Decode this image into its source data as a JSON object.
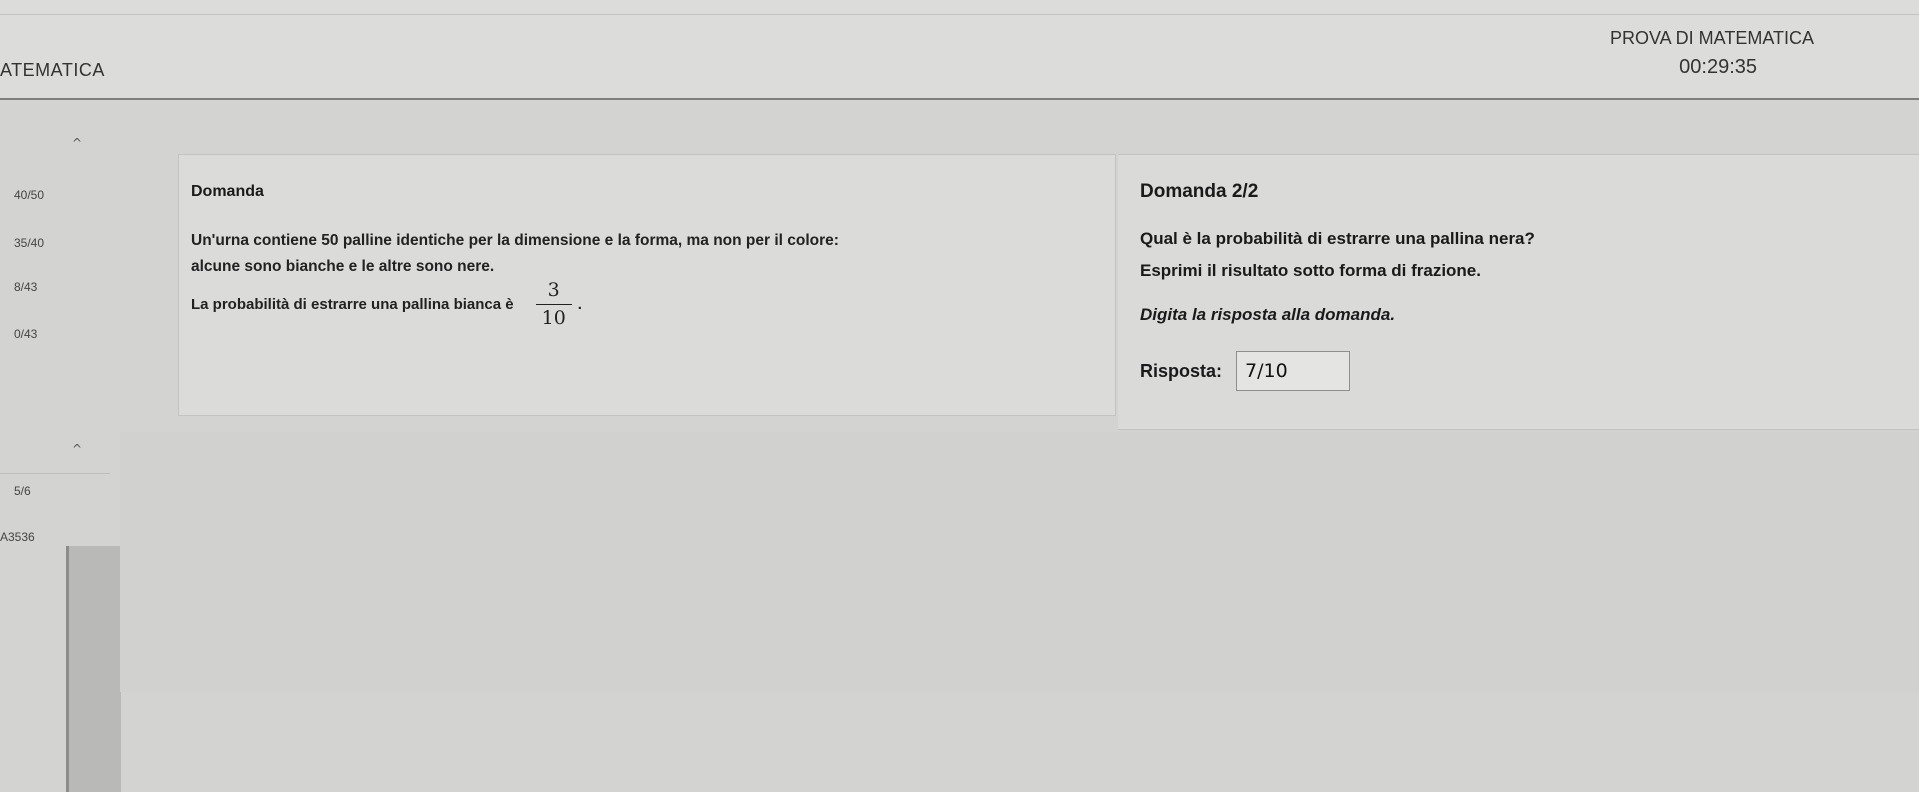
{
  "header": {
    "brand": "ATEMATICA",
    "exam_title": "PROVA DI MATEMATICA",
    "timer": "00:29:35"
  },
  "sidebar": {
    "caret_up": "^",
    "rows": [
      "40/50",
      "35/40",
      "8/43",
      "0/43"
    ],
    "caret_lower": "^",
    "rows_lower": [
      "5/6",
      "A3536"
    ]
  },
  "question_left": {
    "label": "Domanda",
    "line1": "Un'urna contiene 50 palline identiche per la dimensione e la forma, ma non per il colore:",
    "line2": "alcune sono bianche e le altre sono nere.",
    "prob_text": "La probabilità di estrarre una pallina bianca è",
    "frac_num": "3",
    "frac_den": "10",
    "frac_suffix": "."
  },
  "question_right": {
    "title": "Domanda 2/2",
    "line1": "Qual è la probabilità di estrarre una pallina nera?",
    "line2": "Esprimi il risultato sotto forma di frazione.",
    "instruction": "Digita la risposta alla domanda.",
    "answer_label": "Risposta:",
    "answer_value": "7/10"
  }
}
